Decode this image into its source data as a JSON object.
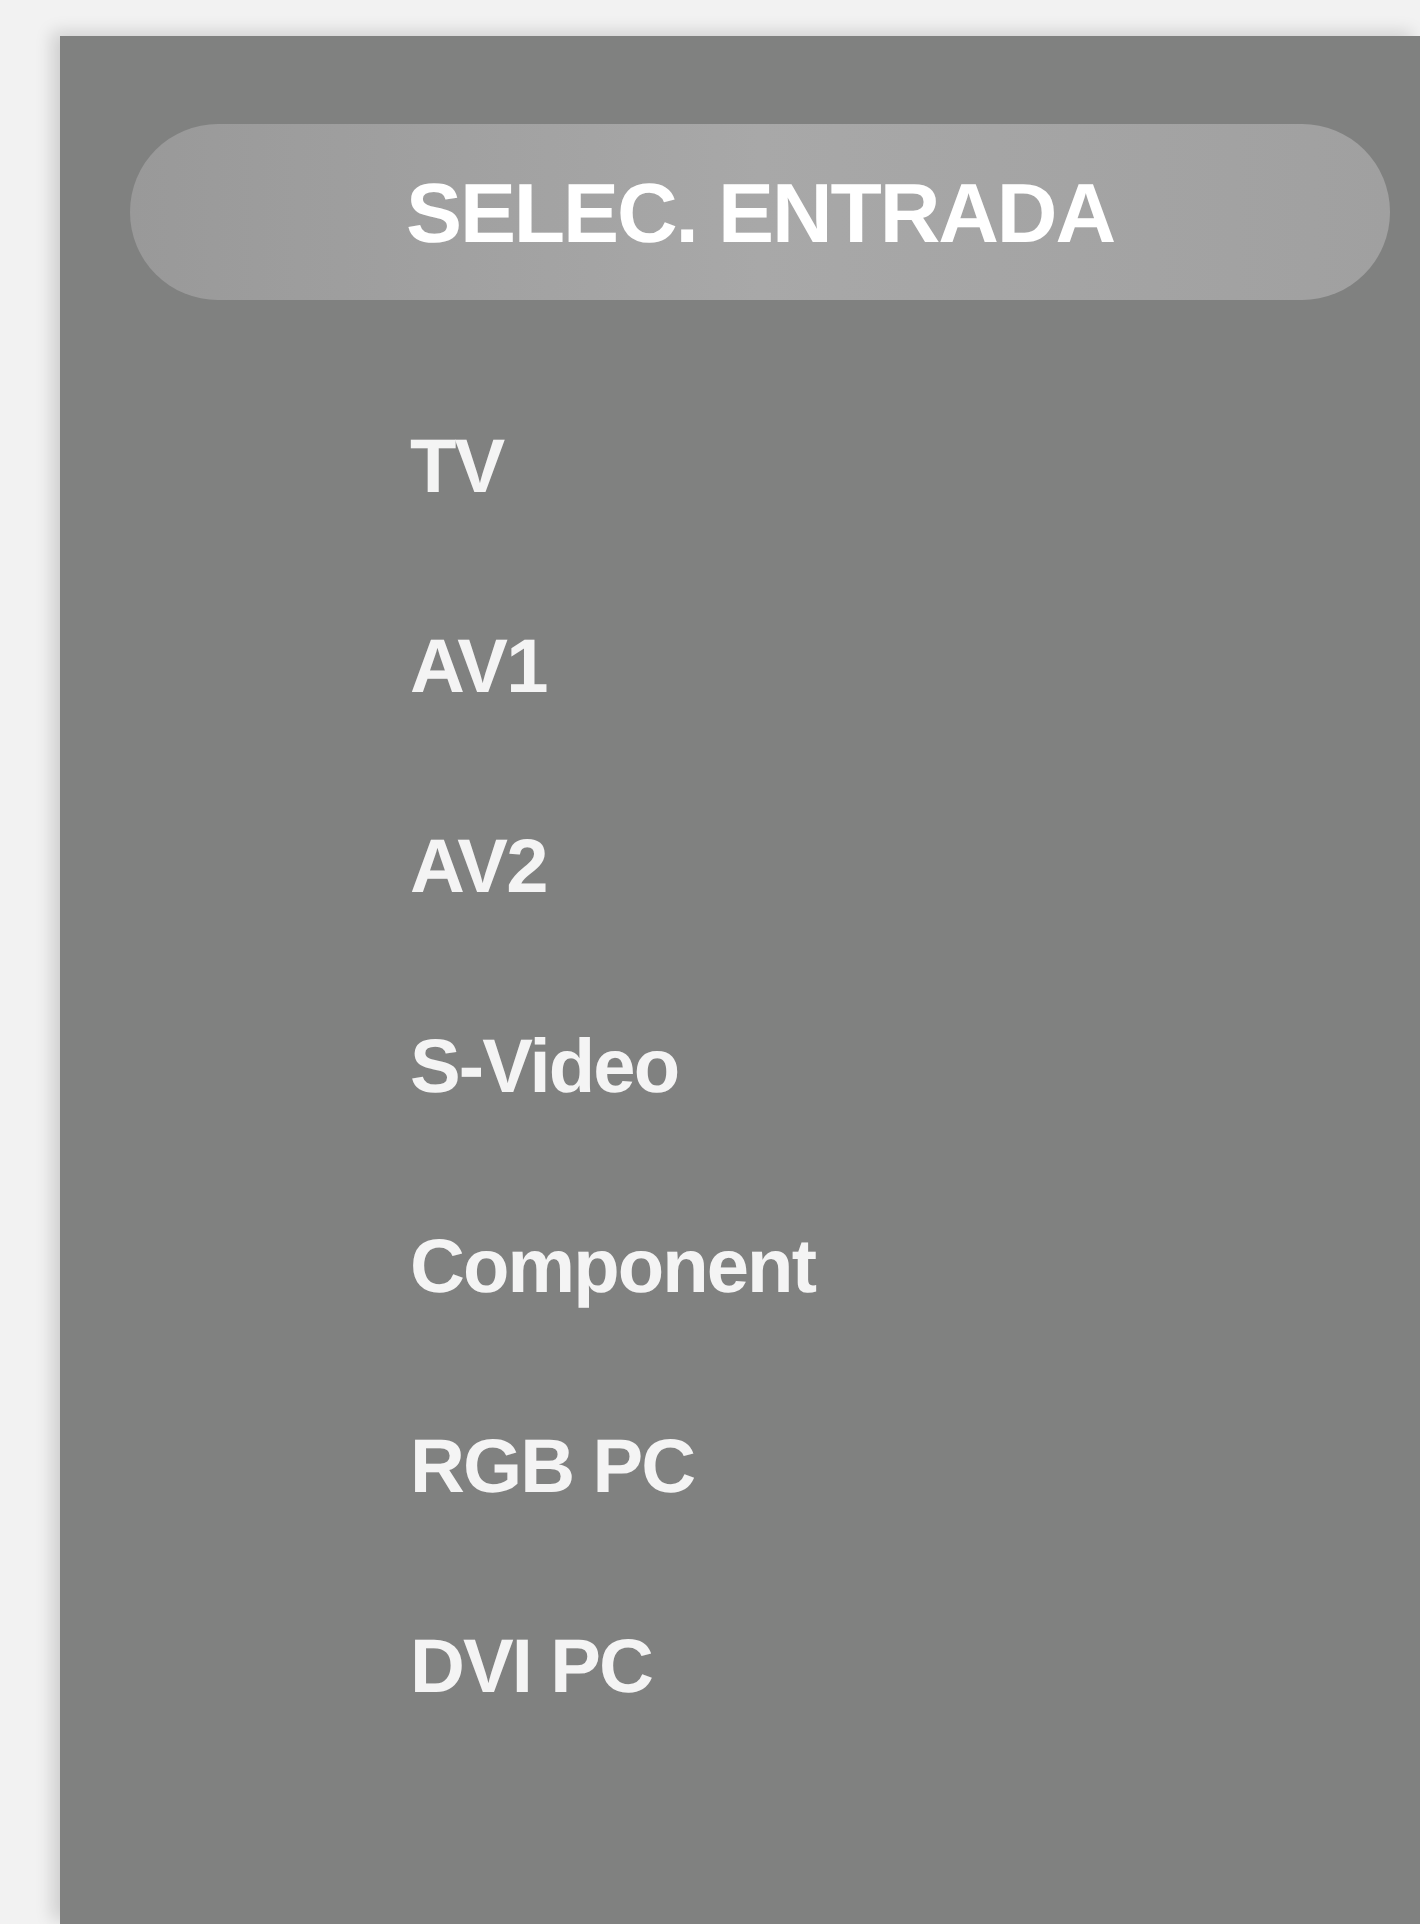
{
  "menu": {
    "title": "SELEC. ENTRADA",
    "items": [
      {
        "label": "TV"
      },
      {
        "label": "AV1"
      },
      {
        "label": "AV2"
      },
      {
        "label": "S-Video"
      },
      {
        "label": "Component"
      },
      {
        "label": "RGB PC"
      },
      {
        "label": "DVI PC"
      }
    ]
  }
}
